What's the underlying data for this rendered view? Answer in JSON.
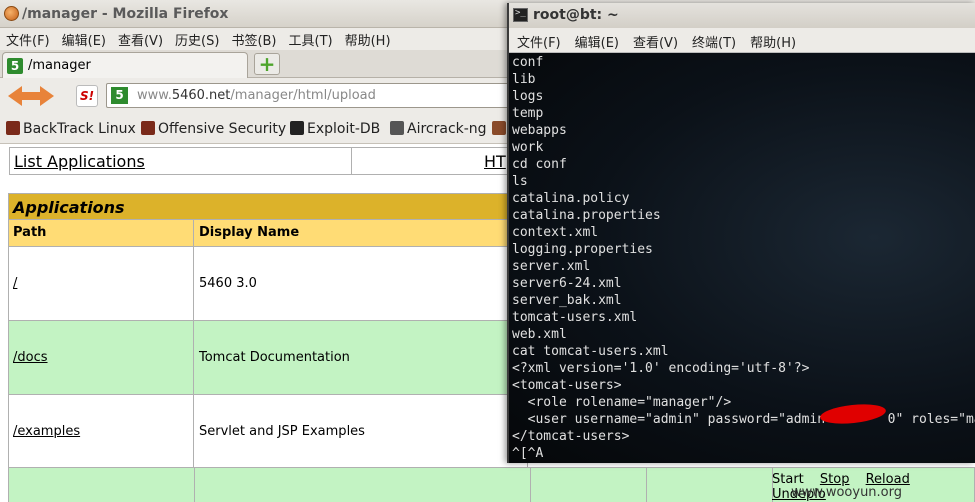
{
  "firefox": {
    "title": "/manager - Mozilla Firefox",
    "menu": [
      "文件(F)",
      "编辑(E)",
      "查看(V)",
      "历史(S)",
      "书签(B)",
      "工具(T)",
      "帮助(H)"
    ],
    "tab_label": "/manager",
    "new_tab": "+",
    "url_prefix": "www.",
    "url_domain": "5460.net",
    "url_path": "/manager/html/upload",
    "bookmarks": [
      "BackTrack Linux",
      "Offensive Security",
      "Exploit-DB",
      "Aircrack-ng"
    ],
    "favicon_text": "5",
    "s_button": "S!"
  },
  "page": {
    "link_list": "List Applications",
    "link_html": "HT",
    "apps_heading": "Applications",
    "col_path": "Path",
    "col_display": "Display Name",
    "rows": [
      {
        "path": "/",
        "display": "5460 3.0"
      },
      {
        "path": "/docs",
        "display": "Tomcat Documentation"
      },
      {
        "path": "/examples",
        "display": "Servlet and JSP Examples"
      }
    ],
    "commands": [
      "Start",
      "Stop",
      "Reload",
      "Undeplo"
    ],
    "watermark": "www.wooyun.org"
  },
  "terminal": {
    "title": "root@bt: ~",
    "menu": [
      "文件(F)",
      "编辑(E)",
      "查看(V)",
      "终端(T)",
      "帮助(H)"
    ],
    "lines": [
      "conf",
      "lib",
      "logs",
      "temp",
      "webapps",
      "work",
      "cd conf",
      "ls",
      "catalina.policy",
      "catalina.properties",
      "context.xml",
      "logging.properties",
      "server.xml",
      "server6-24.xml",
      "server_bak.xml",
      "tomcat-users.xml",
      "web.xml",
      "cat tomcat-users.xml",
      "<?xml version='1.0' encoding='utf-8'?>",
      "<tomcat-users>",
      "  <role rolename=\"manager\"/>",
      "  <user username=\"admin\" password=\"admin        0\" roles=\"ma",
      "</tomcat-users>",
      "^[^A"
    ]
  }
}
